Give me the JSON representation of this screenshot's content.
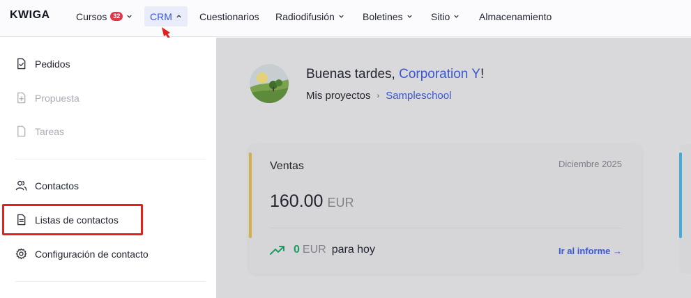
{
  "header": {
    "logo": "KWIGA",
    "nav": [
      {
        "label": "Cursos",
        "badge": "32"
      },
      {
        "label": "CRM",
        "active": true
      },
      {
        "label": "Cuestionarios"
      },
      {
        "label": "Radiodifusión"
      },
      {
        "label": "Boletines"
      },
      {
        "label": "Sitio"
      },
      {
        "label": "Almacenamiento"
      }
    ]
  },
  "sidebar": {
    "items": [
      {
        "label": "Pedidos",
        "icon": "order-document-icon",
        "enabled": true
      },
      {
        "label": "Propuesta",
        "icon": "proposal-document-icon",
        "enabled": false
      },
      {
        "label": "Tareas",
        "icon": "task-document-icon",
        "enabled": false
      },
      {
        "label": "Contactos",
        "icon": "users-icon",
        "enabled": true
      },
      {
        "label": "Listas de contactos",
        "icon": "list-document-icon",
        "enabled": true
      },
      {
        "label": "Configuración de contacto",
        "icon": "gear-icon",
        "enabled": true
      }
    ]
  },
  "main": {
    "greeting_prefix": "Buenas tardes, ",
    "greeting_name": "Corporation Y",
    "greeting_suffix": "!",
    "breadcrumb": {
      "root": "Mis proyectos",
      "current": "Sampleschool"
    },
    "sales_card": {
      "title": "Ventas",
      "date": "Diciembre 2025",
      "amount": "160.00",
      "currency": "EUR",
      "today_value": "0",
      "today_currency": "EUR",
      "today_label": "para hoy",
      "report_link": "Ir al informe →"
    }
  },
  "colors": {
    "accent": "#3b56d1",
    "badge": "#e0394a",
    "highlight": "#e2211c",
    "sales_accent": "#d2b048",
    "second_card_accent": "#49a9d8",
    "positive": "#1f9a62"
  }
}
